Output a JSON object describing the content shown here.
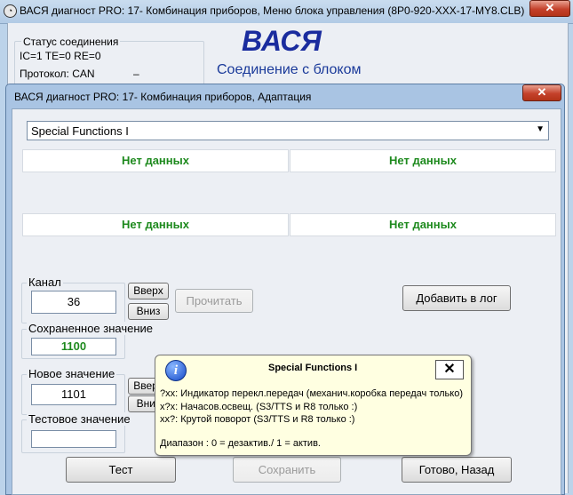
{
  "main_window": {
    "title": "ВАСЯ диагност PRO: 17- Комбинация приборов,  Меню блока управления (8P0-920-XXX-17-MY8.CLB)",
    "close_label": "✕",
    "connection_status": {
      "legend": "Статус соединения",
      "line1": "IC=1  TE=0  RE=0",
      "line2": "Протокол: CAN",
      "dash": "–"
    },
    "logo": "ВАСЯ",
    "connection_text": "Соединение с блоком"
  },
  "dialog": {
    "title": "ВАСЯ диагност PRO: 17- Комбинация приборов, Адаптация",
    "close_label": "✕",
    "combo_value": "Special Functions I",
    "no_data": [
      "Нет данных",
      "Нет данных",
      "Нет данных",
      "Нет данных"
    ],
    "channel": {
      "label": "Канал",
      "value": "36",
      "up": "Вверх",
      "down": "Вниз"
    },
    "read_button": "Прочитать",
    "add_log_button": "Добавить в лог",
    "saved": {
      "label": "Сохраненное значение",
      "value": "1100"
    },
    "new_value": {
      "label": "Новое значение",
      "value": "1101",
      "up": "Вверх",
      "down": "Вниз"
    },
    "test_value": {
      "label": "Тестовое значение",
      "value": ""
    },
    "test_button": "Тест",
    "save_button": "Сохранить",
    "done_button": "Готово, Назад"
  },
  "tooltip": {
    "icon": "i",
    "title": "Special Functions I",
    "close_label": "✕",
    "lines": [
      "?xx: Индикатор перекл.передач (механич.коробка передач только)",
      "x?x: Начасов.освещ. (S3/TTS и R8 только :)",
      "xx?: Крутой поворот  (S3/TTS и R8 только :)",
      "Диапазон : 0 = дезактив./ 1 = актив."
    ]
  }
}
